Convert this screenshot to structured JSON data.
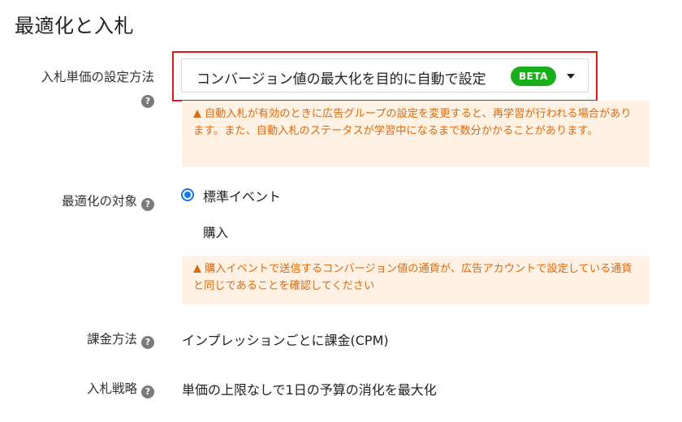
{
  "section": {
    "title": "最適化と入札"
  },
  "bid_method": {
    "label": "入札単価の設定方法",
    "help_icon": "?",
    "selected_value": "コンバージョン値の最大化を目的に自動で設定",
    "badge": "BETA",
    "warning": "自動入札が有効のときに広告グループの設定を変更すると、再学習が行われる場合があります。また、自動入札のステータスが学習中になるまで数分かかることがあります。"
  },
  "optimization": {
    "label": "最適化の対象",
    "help_icon": "?",
    "radio_label": "標準イベント",
    "event": "購入",
    "warning": "購入イベントで送信するコンバージョン値の通貨が、広告アカウントで設定している通貨と同じであることを確認してください"
  },
  "billing": {
    "label": "課金方法",
    "help_icon": "?",
    "value": "インプレッションごとに課金(CPM)"
  },
  "strategy": {
    "label": "入札戦略",
    "help_icon": "?",
    "value": "単価の上限なしで1日の予算の消化を最大化"
  },
  "colors": {
    "highlight": "#e01818",
    "badge": "#1aaf1a",
    "warning_bg": "#fff1e4",
    "warning_text": "#d96a10",
    "radio": "#1677e6"
  }
}
